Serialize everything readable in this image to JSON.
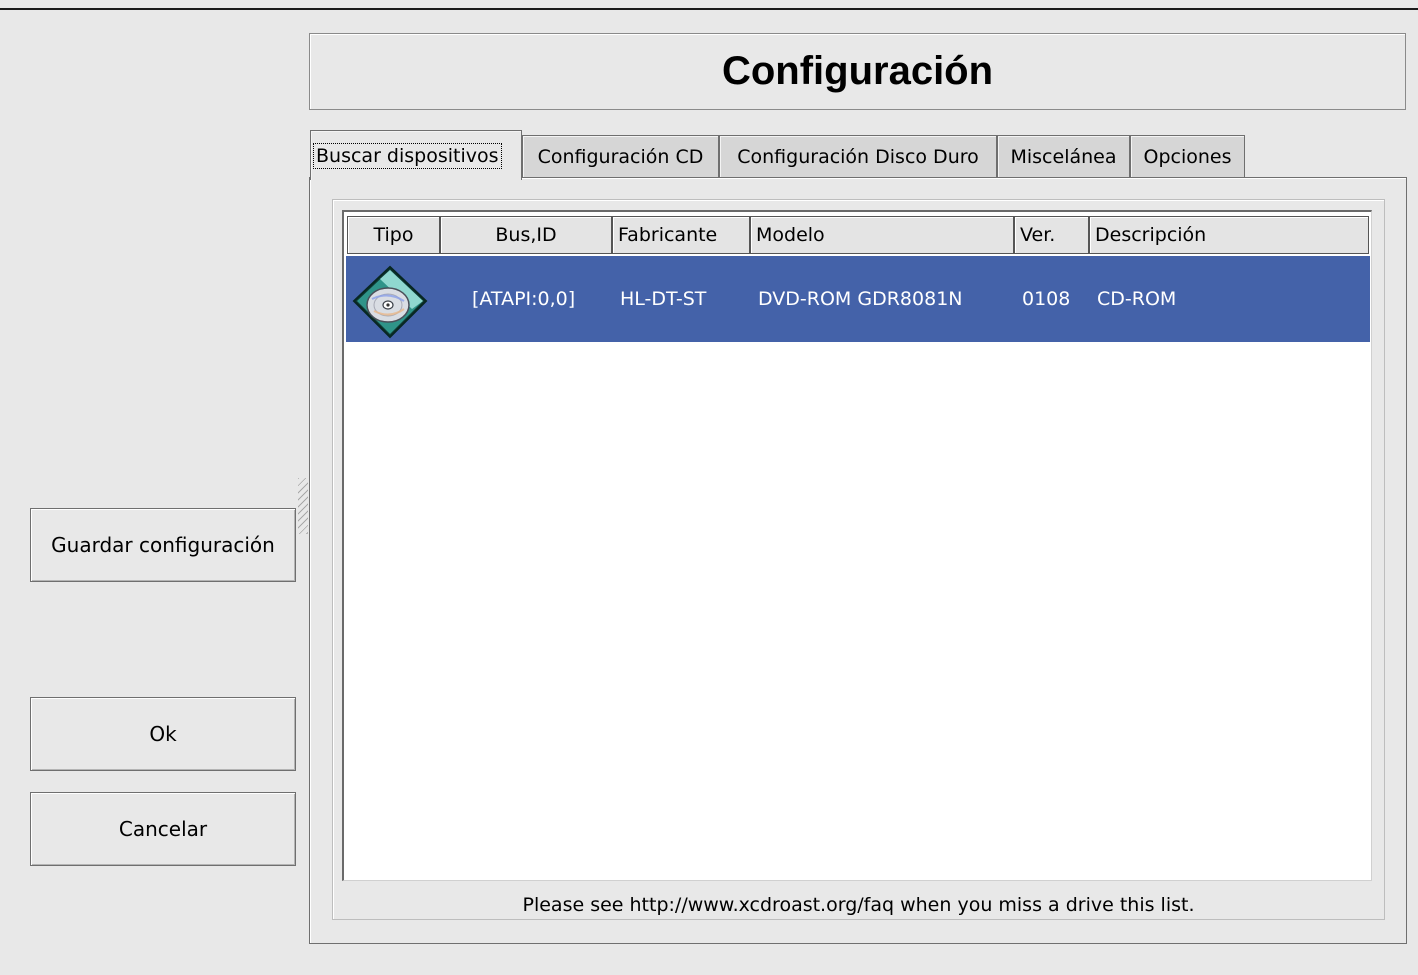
{
  "window": {
    "title": "Configuración"
  },
  "actions": {
    "save_label": "Guardar configuración",
    "ok_label": "Ok",
    "cancel_label": "Cancelar"
  },
  "tabs": [
    {
      "label": "Buscar dispositivos",
      "active": true
    },
    {
      "label": "Configuración CD",
      "active": false
    },
    {
      "label": "Configuración Disco Duro",
      "active": false
    },
    {
      "label": "Miscelánea",
      "active": false
    },
    {
      "label": "Opciones",
      "active": false
    }
  ],
  "device_table": {
    "columns": [
      "Tipo",
      "Bus,ID",
      "Fabricante",
      "Modelo",
      "Ver.",
      "Descripción"
    ],
    "rows": [
      {
        "tipo_icon": "cdrom-drive-icon",
        "bus_id": "[ATAPI:0,0]",
        "fabricante": "HL-DT-ST",
        "modelo": "DVD-ROM GDR8081N",
        "ver": "0108",
        "descripcion": "CD-ROM",
        "selected": true
      }
    ]
  },
  "footer": {
    "message": "Please see http://www.xcdroast.org/faq when you miss a drive this list."
  },
  "colors": {
    "selection": "#4462a9",
    "background": "#e8e8e8",
    "list_background": "#ffffff"
  }
}
